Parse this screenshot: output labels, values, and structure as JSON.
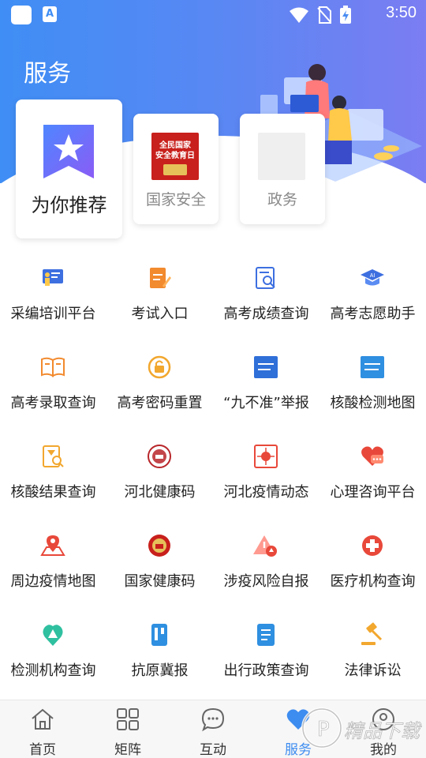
{
  "status_bar": {
    "time": "3:50",
    "app_badge": "A"
  },
  "page": {
    "title": "服务"
  },
  "recommend": [
    {
      "label": "为你推荐"
    },
    {
      "label": "国家安全",
      "thumb_text_1": "全民国家",
      "thumb_text_2": "安全教育日"
    },
    {
      "label": "政务"
    }
  ],
  "services": [
    {
      "label": "采编培训平台",
      "icon": "teacher-board-icon",
      "color": "#3d6fe0"
    },
    {
      "label": "考试入口",
      "icon": "exam-pen-icon",
      "color": "#f28a2e"
    },
    {
      "label": "高考成绩查询",
      "icon": "score-search-icon",
      "color": "#3d6fe0"
    },
    {
      "label": "高考志愿助手",
      "icon": "ai-graduation-cap-icon",
      "color": "#3d6fe0"
    },
    {
      "label": "高考录取查询",
      "icon": "admission-book-icon",
      "color": "#f28a2e"
    },
    {
      "label": "高考密码重置",
      "icon": "lock-reset-icon",
      "color": "#f2a72e"
    },
    {
      "label": "“九不准”举报",
      "icon": "nine-prohibitions-icon",
      "color": "#2f6fd8"
    },
    {
      "label": "核酸检测地图",
      "icon": "nucleic-map-icon",
      "color": "#2f8fe0"
    },
    {
      "label": "核酸结果查询",
      "icon": "hourglass-search-icon",
      "color": "#f2a72e"
    },
    {
      "label": "河北健康码",
      "icon": "hebei-health-code-icon",
      "color": "#b8262a"
    },
    {
      "label": "河北疫情动态",
      "icon": "virus-dynamics-icon",
      "color": "#e8483a"
    },
    {
      "label": "心理咨询平台",
      "icon": "heart-chat-icon",
      "color": "#e8483a"
    },
    {
      "label": "周边疫情地图",
      "icon": "map-pin-icon",
      "color": "#e8483a"
    },
    {
      "label": "国家健康码",
      "icon": "national-emblem-icon",
      "color": "#c8201c"
    },
    {
      "label": "涉疫风险自报",
      "icon": "risk-warning-icon",
      "color": "#e8483a"
    },
    {
      "label": "医疗机构查询",
      "icon": "medical-cross-icon",
      "color": "#e8483a"
    },
    {
      "label": "检测机构查询",
      "icon": "test-agency-icon",
      "color": "#2fc0a0"
    },
    {
      "label": "抗原冀报",
      "icon": "antigen-kit-icon",
      "color": "#2f8fe0"
    },
    {
      "label": "出行政策查询",
      "icon": "policy-document-icon",
      "color": "#2f8fe0"
    },
    {
      "label": "法律诉讼",
      "icon": "gavel-icon",
      "color": "#f2a72e"
    }
  ],
  "bottom_nav": [
    {
      "label": "首页",
      "icon": "home-icon",
      "active": false
    },
    {
      "label": "矩阵",
      "icon": "grid-icon",
      "active": false
    },
    {
      "label": "互动",
      "icon": "chat-bubble-icon",
      "active": false
    },
    {
      "label": "服务",
      "icon": "heart-icon",
      "active": true
    },
    {
      "label": "我的",
      "icon": "user-icon",
      "active": false
    }
  ],
  "colors": {
    "accent": "#3d8cf0",
    "header_start": "#3f8ef5",
    "header_end": "#7b7df2"
  },
  "watermark": {
    "text": "精品下载"
  }
}
